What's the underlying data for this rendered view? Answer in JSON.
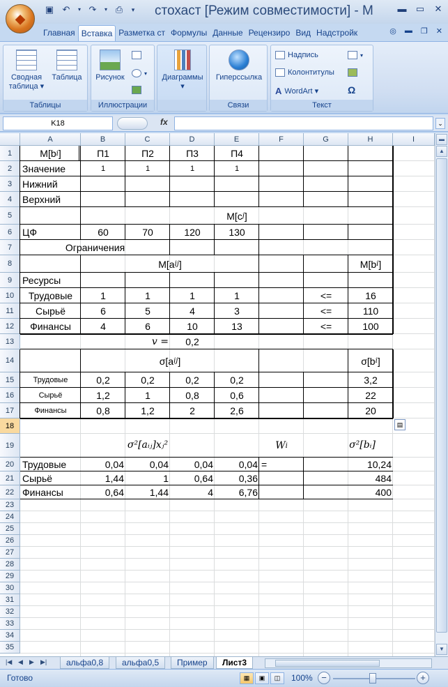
{
  "window": {
    "title": "стохаст  [Режим совместимости] - M"
  },
  "ribbon": {
    "tabs": [
      "Главная",
      "Вставка",
      "Разметка ст",
      "Формулы",
      "Данные",
      "Рецензиро",
      "Вид",
      "Надстройк"
    ],
    "active_tab": "Вставка",
    "groups": {
      "tables": {
        "label": "Таблицы",
        "pivot": "Сводная",
        "pivot2": "таблица ▾",
        "table": "Таблица"
      },
      "illustrations": {
        "label": "Иллюстрации",
        "picture": "Рисунок"
      },
      "charts": {
        "label": "Диаграммы",
        "sub": "▾"
      },
      "links": {
        "label": "Связи",
        "hyperlink": "Гиперссылка"
      },
      "text": {
        "label": "Текст",
        "textbox": "Надпись",
        "headers": "Колонтитулы",
        "wordart": "WordArt ▾"
      }
    }
  },
  "formula_bar": {
    "name_box": "K18",
    "fx": "fx",
    "value": ""
  },
  "grid": {
    "columns": [
      "A",
      "B",
      "C",
      "D",
      "E",
      "F",
      "G",
      "H",
      "I"
    ],
    "rows": [
      "1",
      "2",
      "3",
      "4",
      "5",
      "6",
      "7",
      "8",
      "9",
      "10",
      "11",
      "12",
      "13",
      "14",
      "15",
      "16",
      "17",
      "18",
      "19",
      "20",
      "21",
      "22",
      "23",
      "24",
      "25",
      "26",
      "27",
      "28",
      "29",
      "30",
      "31",
      "32",
      "33",
      "34",
      "35"
    ],
    "selected_row": "18",
    "cells": {
      "A1": "M[b",
      "A1s": "i",
      "A1e": "]",
      "B1": "П1",
      "C1": "П2",
      "D1": "П3",
      "E1": "П4",
      "A2": "Значение",
      "B2": "1",
      "C2": "1",
      "D2": "1",
      "E2": "1",
      "A3": "Нижний",
      "A4": "Верхний",
      "M5": "M[c",
      "M5s": "j",
      "M5e": "]",
      "A6": "ЦФ",
      "B6": "60",
      "C6": "70",
      "D6": "120",
      "E6": "130",
      "A7": "Ограничения",
      "M8": "M[a",
      "M8s": "ij",
      "M8e": "]",
      "H8": "M[b",
      "H8s": "i",
      "H8e": "]",
      "A9": "Ресурсы",
      "A10": "Трудовые",
      "B10": "1",
      "C10": "1",
      "D10": "1",
      "E10": "1",
      "G10": "<=",
      "H10": "16",
      "A11": "Сырьё",
      "B11": "6",
      "C11": "5",
      "D11": "4",
      "E11": "3",
      "G11": "<=",
      "H11": "110",
      "A12": "Финансы",
      "B12": "4",
      "C12": "6",
      "D12": "10",
      "E12": "13",
      "G12": "<=",
      "H12": "100",
      "C13": "v =",
      "D13": "0,2",
      "S14": "σ[a",
      "S14s": "ij",
      "S14e": "]",
      "H14": "σ[b",
      "H14s": "i",
      "H14e": "]",
      "A15": "Трудовые",
      "B15": "0,2",
      "C15": "0,2",
      "D15": "0,2",
      "E15": "0,2",
      "H15": "3,2",
      "A16": "Сырьё",
      "B16": "1,2",
      "C16": "1",
      "D16": "0,8",
      "E16": "0,6",
      "H16": "22",
      "A17": "Финансы",
      "B17": "0,8",
      "C17": "1,2",
      "D17": "2",
      "E17": "2,6",
      "H17": "20",
      "F19": "W",
      "F19s": "i",
      "A20": "Трудовые",
      "B20": "0,04",
      "C20": "0,04",
      "D20": "0,04",
      "E20": "0,04",
      "F20": "=",
      "H20": "10,24",
      "A21": "Сырьё",
      "B21": "1,44",
      "C21": "1",
      "D21": "0,64",
      "E21": "0,36",
      "H21": "484",
      "A22": "Финансы",
      "B22": "0,64",
      "C22": "1,44",
      "D22": "4",
      "E22": "6,76",
      "H22": "400"
    }
  },
  "sheets": {
    "tabs": [
      "альфа0,8",
      "альфа0,5",
      "Пример",
      "Лист3"
    ],
    "active": "Лист3"
  },
  "status": {
    "text": "Готово",
    "zoom": "100%"
  }
}
